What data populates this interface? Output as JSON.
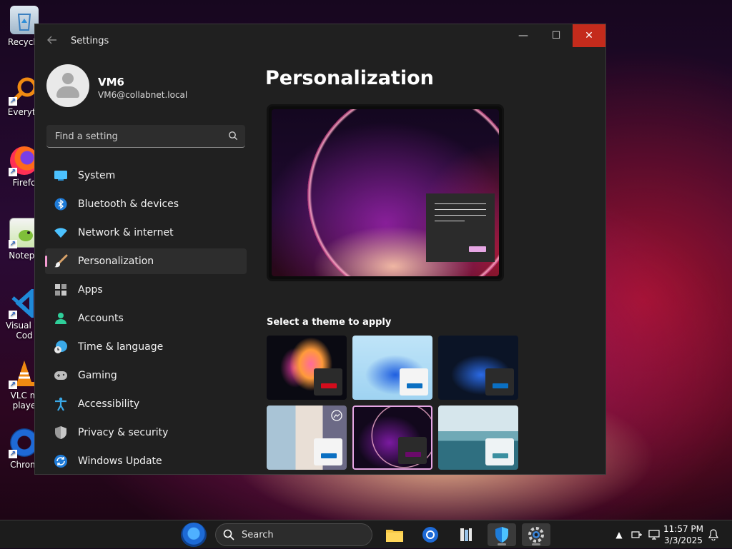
{
  "desktop": {
    "icons": [
      {
        "label": "Recycle",
        "icon": "recycle-bin-icon"
      },
      {
        "label": "Everyth",
        "icon": "everything-search-icon"
      },
      {
        "label": "Firefo",
        "icon": "firefox-icon"
      },
      {
        "label": "Notepa",
        "icon": "notepad-plus-plus-icon"
      },
      {
        "label": "Visual St",
        "label2": "Cod",
        "icon": "vscode-icon"
      },
      {
        "label": "VLC m",
        "label2": "playe",
        "icon": "vlc-icon"
      },
      {
        "label": "Chrom",
        "icon": "chrome-icon"
      }
    ]
  },
  "window": {
    "title": "Settings",
    "back_icon": "arrow-left-icon",
    "minimize_glyph": "—",
    "maximize_glyph": "☐",
    "close_glyph": "✕"
  },
  "profile": {
    "name": "VM6",
    "email": "VM6@collabnet.local"
  },
  "search": {
    "placeholder": "Find a setting",
    "value": ""
  },
  "sidebar": {
    "items": [
      {
        "label": "System",
        "icon": "system-display-icon",
        "selected": false
      },
      {
        "label": "Bluetooth & devices",
        "icon": "bluetooth-icon",
        "selected": false
      },
      {
        "label": "Network & internet",
        "icon": "wifi-icon",
        "selected": false
      },
      {
        "label": "Personalization",
        "icon": "paintbrush-icon",
        "selected": true
      },
      {
        "label": "Apps",
        "icon": "apps-icon",
        "selected": false
      },
      {
        "label": "Accounts",
        "icon": "accounts-icon",
        "selected": false
      },
      {
        "label": "Time & language",
        "icon": "time-language-icon",
        "selected": false
      },
      {
        "label": "Gaming",
        "icon": "gamepad-icon",
        "selected": false
      },
      {
        "label": "Accessibility",
        "icon": "accessibility-icon",
        "selected": false
      },
      {
        "label": "Privacy & security",
        "icon": "shield-icon",
        "selected": false
      },
      {
        "label": "Windows Update",
        "icon": "windows-update-icon",
        "selected": false
      }
    ]
  },
  "main": {
    "title": "Personalization",
    "theme_section_label": "Select a theme to apply",
    "themes": [
      {
        "name": "glow",
        "accent": "#d40c1c",
        "selected": false
      },
      {
        "name": "windows-light",
        "accent": "#0a6fc2",
        "selected": false
      },
      {
        "name": "windows-dark",
        "accent": "#0a6fc2",
        "selected": false
      },
      {
        "name": "spotlight",
        "accent": "#0a6fc2",
        "selected": false
      },
      {
        "name": "current-purple",
        "accent": "#6a0a6a",
        "selected": true
      },
      {
        "name": "flow",
        "accent": "#3a8fa0",
        "selected": false
      }
    ]
  },
  "taskbar": {
    "search_label": "Search",
    "apps": [
      "file-explorer-icon",
      "chrome-icon",
      "library-icon",
      "defender-shield-icon",
      "settings-gear-icon"
    ],
    "time": "11:57 PM",
    "date": "3/3/2025"
  },
  "colors": {
    "accent_pink": "#e6a6e4",
    "close_red": "#c42b1c",
    "window_bg": "#202020"
  }
}
